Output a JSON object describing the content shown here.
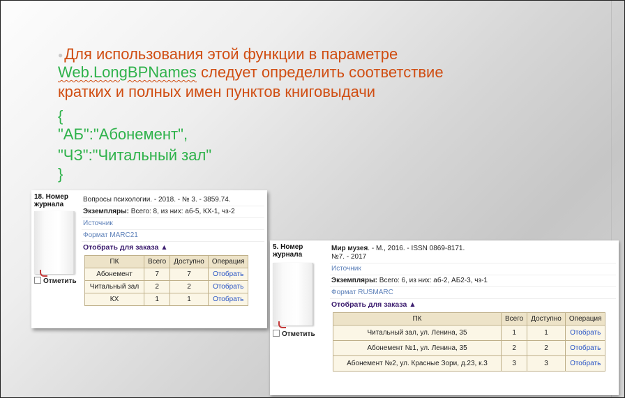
{
  "slide": {
    "line1": "Для использования этой функции в параметре",
    "param": "Web.LongBPNames",
    "line2_rest": " следует определить соответствие",
    "line3": "кратких и полных имен пунктов книговыдачи",
    "brace_open": "{",
    "map1": "\"АБ\":\"Абонемент\",",
    "map2": "\"ЧЗ\":\"Читальный зал\"",
    "brace_close": "}"
  },
  "card1": {
    "number": "18. Номер журнала",
    "mark_label": "Отметить",
    "title": "Вопросы психологии. - 2018. - № 3. - 3859.74.",
    "copies_label": "Экземпляры:",
    "copies_value": " Всего: 8, из них: аб-5, КХ-1, чз-2",
    "source": "Источник",
    "format": "Формат MARC21",
    "order": "Отобрать для заказа ▲",
    "table": {
      "headers": [
        "ПК",
        "Всего",
        "Доступно",
        "Операция"
      ],
      "rows": [
        [
          "Абонемент",
          "7",
          "7",
          "Отобрать"
        ],
        [
          "Читальный зал",
          "2",
          "2",
          "Отобрать"
        ],
        [
          "КХ",
          "1",
          "1",
          "Отобрать"
        ]
      ]
    }
  },
  "card2": {
    "number": "5. Номер журнала",
    "mark_label": "Отметить",
    "title_bold": "Мир музея",
    "title_rest": ". - М., 2016. - ISSN 0869-8171.",
    "title_line2": "№7. - 2017",
    "source": "Источник",
    "copies_label": "Экземпляры:",
    "copies_value": " Всего: 6, из них: аб-2, АБ2-3, чз-1",
    "format": "Формат RUSMARC",
    "order": "Отобрать для заказа ▲",
    "table": {
      "headers": [
        "ПК",
        "Всего",
        "Доступно",
        "Операция"
      ],
      "rows": [
        [
          "Читальный зал, ул. Ленина, 35",
          "1",
          "1",
          "Отобрать"
        ],
        [
          "Абонемент №1, ул. Ленина, 35",
          "2",
          "2",
          "Отобрать"
        ],
        [
          "Абонемент №2, ул. Красные Зори, д.23, к.3",
          "3",
          "3",
          "Отобрать"
        ]
      ]
    }
  },
  "colors": {
    "orange": "#d04e13",
    "green": "#2fb24b",
    "link": "#2a55c6",
    "table_bg": "#fbf6e6"
  }
}
